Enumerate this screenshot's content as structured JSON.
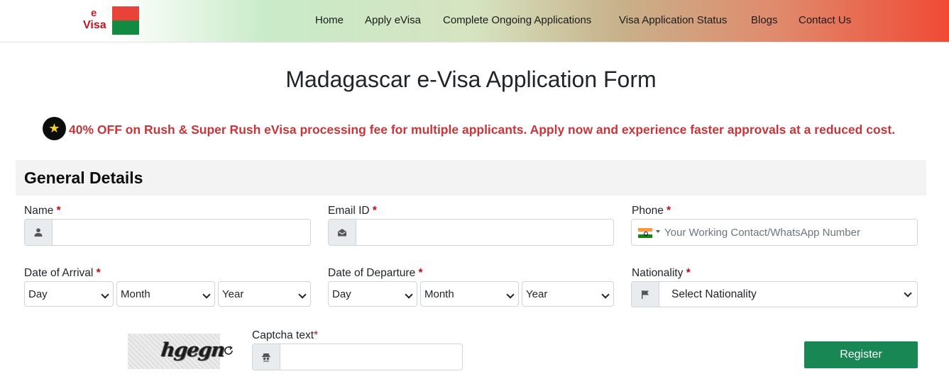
{
  "brand": {
    "logo_line1": "e",
    "logo_line2": "Visa",
    "colors": {
      "red": "#e8423a",
      "green": "#138a42"
    }
  },
  "nav": {
    "items": [
      {
        "label": "Home"
      },
      {
        "label": "Apply eVisa"
      },
      {
        "label": "Complete Ongoing Applications"
      },
      {
        "label": "Visa Application Status"
      },
      {
        "label": "Blogs"
      },
      {
        "label": "Contact Us"
      }
    ]
  },
  "page": {
    "title": "Madagascar e-Visa Application Form"
  },
  "promo": {
    "icon": "star-icon",
    "text": "40% OFF on Rush & Super Rush eVisa processing fee for multiple applicants. Apply now and experience faster approvals at a reduced cost.",
    "color": "#c8363b"
  },
  "section": {
    "title": "General Details"
  },
  "fields": {
    "required_mark": "*",
    "name": {
      "label": "Name",
      "value": "",
      "icon": "user-icon"
    },
    "email": {
      "label": "Email ID",
      "value": "",
      "icon": "envelope-icon"
    },
    "phone": {
      "label": "Phone",
      "placeholder": "Your Working Contact/WhatsApp Number",
      "country": "India",
      "icon": "india-flag-icon"
    },
    "arrival": {
      "label": "Date of Arrival",
      "day": "Day",
      "month": "Month",
      "year": "Year"
    },
    "departure": {
      "label": "Date of Departure",
      "day": "Day",
      "month": "Month",
      "year": "Year"
    },
    "nationality": {
      "label": "Nationality",
      "selected": "Select Nationality",
      "icon": "flag-icon"
    }
  },
  "captcha": {
    "image_text": "hgegn",
    "label": "Captcha text",
    "value": "",
    "icon": "user-secret-icon",
    "refresh_icon": "refresh-icon"
  },
  "actions": {
    "register_label": "Register",
    "register_color": "#198754"
  }
}
